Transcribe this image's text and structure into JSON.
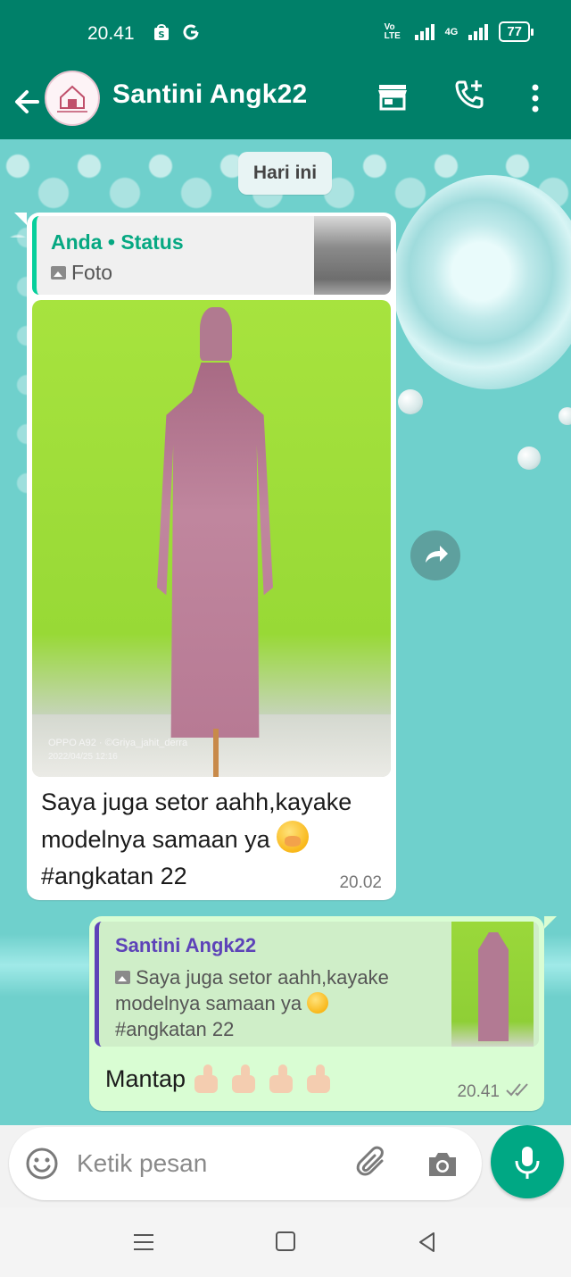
{
  "status_bar": {
    "time": "20.41",
    "network_label": "4G",
    "volte_label": "Vo LTE",
    "battery": "77"
  },
  "header": {
    "title": "Santini Angk22"
  },
  "chat": {
    "date_divider": "Hari ini",
    "incoming": {
      "quote_author": "Anda • Status",
      "quote_type": "Foto",
      "photo_watermark_line1": "OPPO A92 · ©Griya_jahit_derra",
      "photo_watermark_line2": "2022/04/25 12:16",
      "text_line1": "Saya juga setor aahh,kayake",
      "text_line2": "modelnya samaan ya",
      "text_line3": "#angkatan 22",
      "time": "20.02"
    },
    "outgoing": {
      "quote_author": "Santini Angk22",
      "quote_line1": "Saya juga setor aahh,kayake",
      "quote_line2": "modelnya samaan ya",
      "quote_line3": "#angkatan 22",
      "text": "Mantap",
      "time": "20.41"
    }
  },
  "input": {
    "placeholder": "Ketik pesan"
  },
  "colors": {
    "brand": "#008069",
    "accent": "#00a884",
    "outgoing_bubble": "#d9fdd3"
  }
}
